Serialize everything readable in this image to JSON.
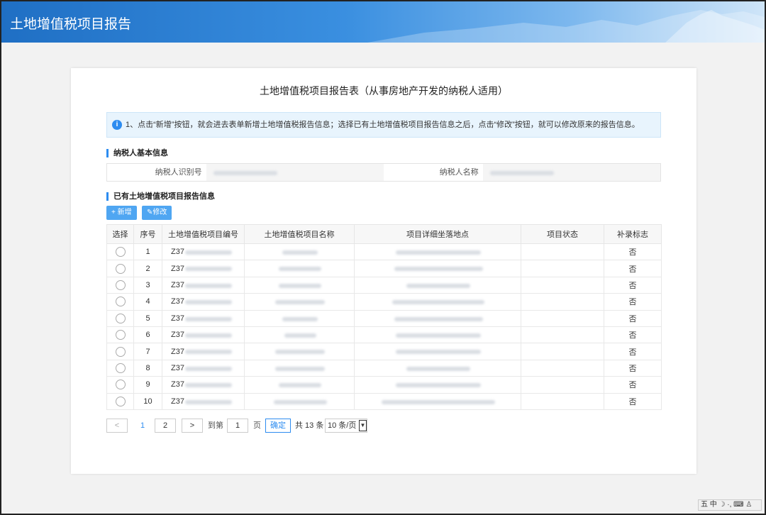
{
  "header": {
    "title": "土地增值税项目报告"
  },
  "card": {
    "title": "土地增值税项目报告表（从事房地产开发的纳税人适用）"
  },
  "notice": {
    "icon": "info-icon",
    "text": "1、点击“新增”按钮，就会进去表单新增土地增值税报告信息；选择已有土地增值税项目报告信息之后，点击“修改”按钮，就可以修改原来的报告信息。"
  },
  "taxpayer": {
    "section_title": "纳税人基本信息",
    "id_label": "纳税人识别号",
    "name_label": "纳税人名称"
  },
  "projects": {
    "section_title": "已有土地增值税项目报告信息",
    "add_button": "+ 新增",
    "edit_button": "修改",
    "columns": [
      "选择",
      "序号",
      "土地增值税项目编号",
      "土地增值税项目名称",
      "项目详细坐落地点",
      "项目状态",
      "补录标志"
    ],
    "rows": [
      {
        "no": "1",
        "code": "Z37",
        "flag": "否"
      },
      {
        "no": "2",
        "code": "Z37",
        "flag": "否"
      },
      {
        "no": "3",
        "code": "Z37",
        "flag": "否"
      },
      {
        "no": "4",
        "code": "Z37",
        "flag": "否"
      },
      {
        "no": "5",
        "code": "Z37",
        "flag": "否"
      },
      {
        "no": "6",
        "code": "Z37",
        "flag": "否"
      },
      {
        "no": "7",
        "code": "Z37",
        "flag": "否"
      },
      {
        "no": "8",
        "code": "Z37",
        "flag": "否"
      },
      {
        "no": "9",
        "code": "Z37",
        "flag": "否"
      },
      {
        "no": "10",
        "code": "Z37",
        "flag": "否"
      }
    ]
  },
  "pager": {
    "prev": "<",
    "page1": "1",
    "page2": "2",
    "next": ">",
    "goto_label": "到第",
    "goto_value": "1",
    "page_unit": "页",
    "confirm": "确定",
    "total": "共 13 条",
    "page_size": "10 条/页"
  },
  "ime": {
    "text": "五 中 ☽ ·, ⌨ ♙"
  }
}
